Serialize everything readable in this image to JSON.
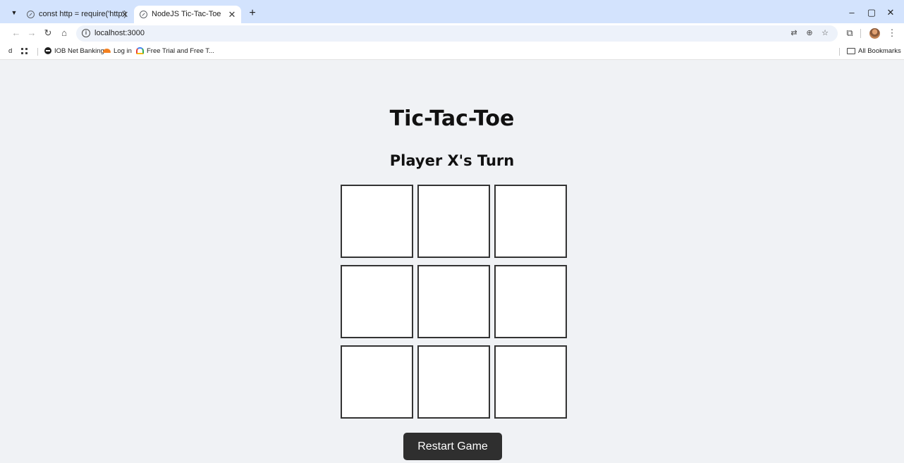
{
  "browser": {
    "tabs": [
      {
        "title": "const http = require('http')",
        "close": "✕"
      },
      {
        "title": "NodeJS Tic-Tac-Toe",
        "close": "✕"
      }
    ],
    "new_tab": "+",
    "window_controls": {
      "minimize": "–",
      "restore": "▢",
      "close": "✕"
    },
    "url": "localhost:3000",
    "bookmarks": [
      {
        "label": "IOB Net Banking",
        "icon": "globe-icon"
      },
      {
        "label": "Log in",
        "icon": "cloudflare-icon"
      },
      {
        "label": "Free Trial and Free T...",
        "icon": "google-cloud-icon"
      }
    ],
    "bookmarks_first": "d",
    "all_bookmarks": "All Bookmarks"
  },
  "game": {
    "title": "Tic-Tac-Toe",
    "status": "Player X's Turn",
    "cells": [
      "",
      "",
      "",
      "",
      "",
      "",
      "",
      "",
      ""
    ],
    "restart_label": "Restart Game"
  },
  "colors": {
    "tabstrip": "#d3e3fd",
    "page_background": "#f0f2f5",
    "cell_border": "#333333",
    "button_background": "#2f2f2f"
  }
}
